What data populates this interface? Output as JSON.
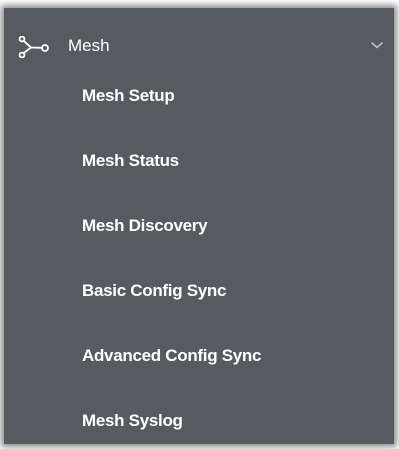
{
  "menu": {
    "title": "Mesh",
    "icon": "mesh-network-icon",
    "expanded_indicator": "chevron-down-icon",
    "background_color": "#575b60",
    "text_color": "#ffffff",
    "items": [
      {
        "label": "Mesh Setup"
      },
      {
        "label": "Mesh Status"
      },
      {
        "label": "Mesh Discovery"
      },
      {
        "label": "Basic Config Sync"
      },
      {
        "label": "Advanced Config Sync"
      },
      {
        "label": "Mesh Syslog"
      }
    ]
  }
}
